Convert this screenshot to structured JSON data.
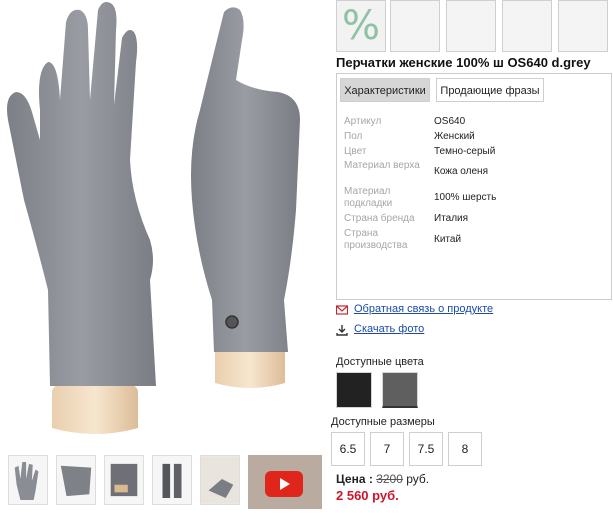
{
  "badges": {
    "percent_symbol": "%"
  },
  "product": {
    "title": "Перчатки женские 100% ш OS640 d.grey"
  },
  "tabs": [
    {
      "label": "Характеристики",
      "active": true
    },
    {
      "label": "Продающие фразы",
      "active": false
    }
  ],
  "specs": [
    {
      "key": "Артикул",
      "value": "OS640"
    },
    {
      "key": "Пол",
      "value": "Женский"
    },
    {
      "key": "Цвет",
      "value": "Темно-серый"
    },
    {
      "key": "Материал верха",
      "value": "Кожа оленя"
    },
    {
      "key": "Материал подкладки",
      "value": "100% шерсть"
    },
    {
      "key": "Страна бренда",
      "value": "Италия"
    },
    {
      "key": "Страна производства",
      "value": "Китай"
    }
  ],
  "links": {
    "feedback": "Обратная связь о продукте",
    "download_photo": "Скачать фото"
  },
  "colors": {
    "label": "Доступные цвета",
    "swatches": [
      {
        "name": "black",
        "hex": "#222222",
        "selected": false
      },
      {
        "name": "dark-grey",
        "hex": "#5f5f5f",
        "selected": true
      }
    ]
  },
  "sizes": {
    "label": "Доступные размеры",
    "options": [
      "6.5",
      "7",
      "7.5",
      "8"
    ]
  },
  "price": {
    "label": "Цена :",
    "old_value": "3200",
    "currency": "руб.",
    "new_value": "2 560 руб."
  },
  "colors_theme": {
    "accent_green": "#8fc2a5",
    "link_blue": "#1c4aa7",
    "price_red": "#d0142c",
    "video_red": "#e0261a"
  }
}
